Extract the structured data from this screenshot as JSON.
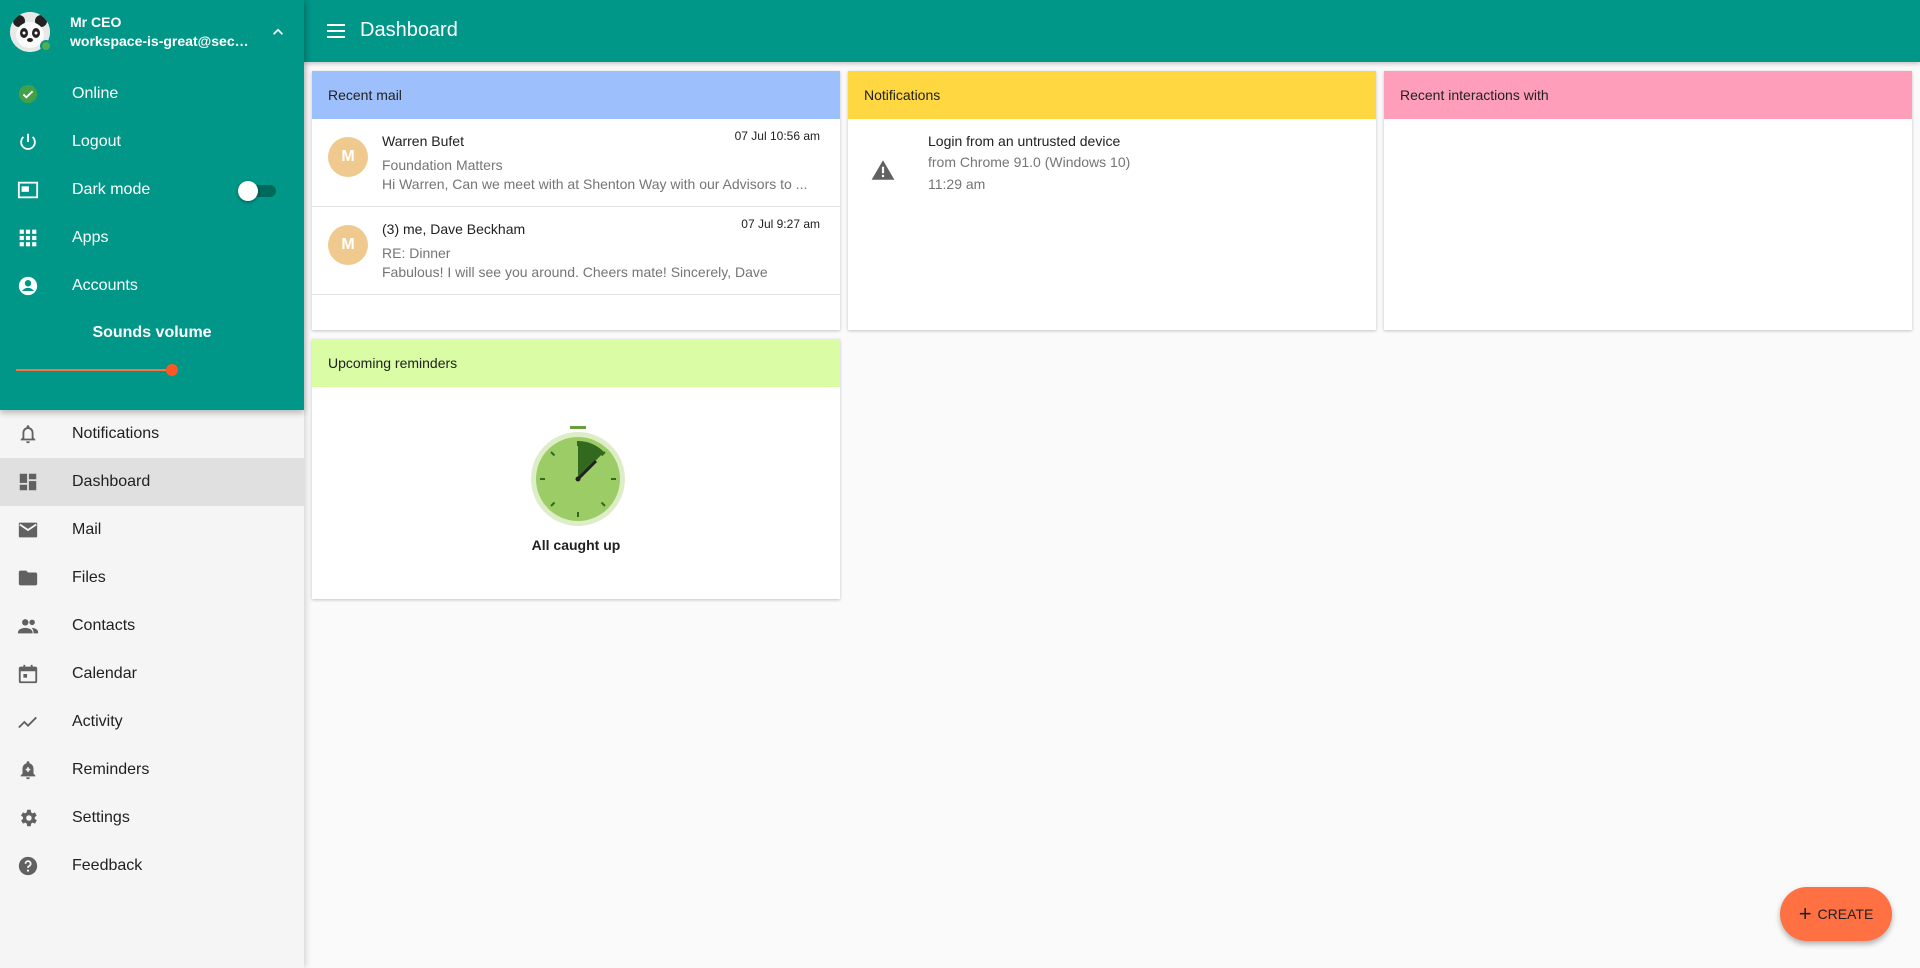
{
  "profile": {
    "name": "Mr CEO",
    "email": "workspace-is-great@secur..."
  },
  "account_menu": [
    {
      "label": "Online",
      "icon": "check-circle-icon"
    },
    {
      "label": "Logout",
      "icon": "power-icon"
    },
    {
      "label": "Dark mode",
      "icon": "picture-in-picture-icon"
    },
    {
      "label": "Apps",
      "icon": "apps-grid-icon"
    },
    {
      "label": "Accounts",
      "icon": "account-circle-icon"
    }
  ],
  "dark_mode_enabled": false,
  "sounds": {
    "label": "Sounds volume",
    "volume": 1.0
  },
  "nav": [
    {
      "label": "Notifications",
      "icon": "bell-icon"
    },
    {
      "label": "Dashboard",
      "icon": "dashboard-icon",
      "active": true
    },
    {
      "label": "Mail",
      "icon": "mail-icon"
    },
    {
      "label": "Files",
      "icon": "folder-icon"
    },
    {
      "label": "Contacts",
      "icon": "people-icon"
    },
    {
      "label": "Calendar",
      "icon": "calendar-icon"
    },
    {
      "label": "Activity",
      "icon": "trending-icon"
    },
    {
      "label": "Reminders",
      "icon": "alarm-bell-icon"
    },
    {
      "label": "Settings",
      "icon": "gear-icon"
    },
    {
      "label": "Feedback",
      "icon": "help-icon"
    }
  ],
  "header": {
    "title": "Dashboard"
  },
  "cards": {
    "recent_mail": {
      "title": "Recent mail",
      "color": "#9dc0fc",
      "items": [
        {
          "initial": "M",
          "from": "Warren Bufet",
          "date": "07 Jul 10:56 am",
          "subject": "Foundation Matters",
          "preview": "Hi Warren, Can we meet with at Shenton Way with our Advisors to ..."
        },
        {
          "initial": "M",
          "from": "(3) me, Dave Beckham",
          "date": "07 Jul 9:27 am",
          "subject": "RE: Dinner",
          "preview": "Fabulous! I will see you around. Cheers mate! Sincerely, Dave"
        }
      ]
    },
    "notifications": {
      "title": "Notifications",
      "color": "#ffd740",
      "item": {
        "title": "Login from an untrusted device",
        "source": "from Chrome 91.0 (Windows 10)",
        "time": "11:29 am"
      }
    },
    "recent_interactions": {
      "title": "Recent interactions with",
      "color": "#ff9ebb"
    },
    "reminders": {
      "title": "Upcoming reminders",
      "color": "#d9fca4",
      "empty_text": "All caught up"
    }
  },
  "fab": {
    "label": "CREATE"
  },
  "colors": {
    "primary": "#009688",
    "accent": "#ff7043"
  }
}
